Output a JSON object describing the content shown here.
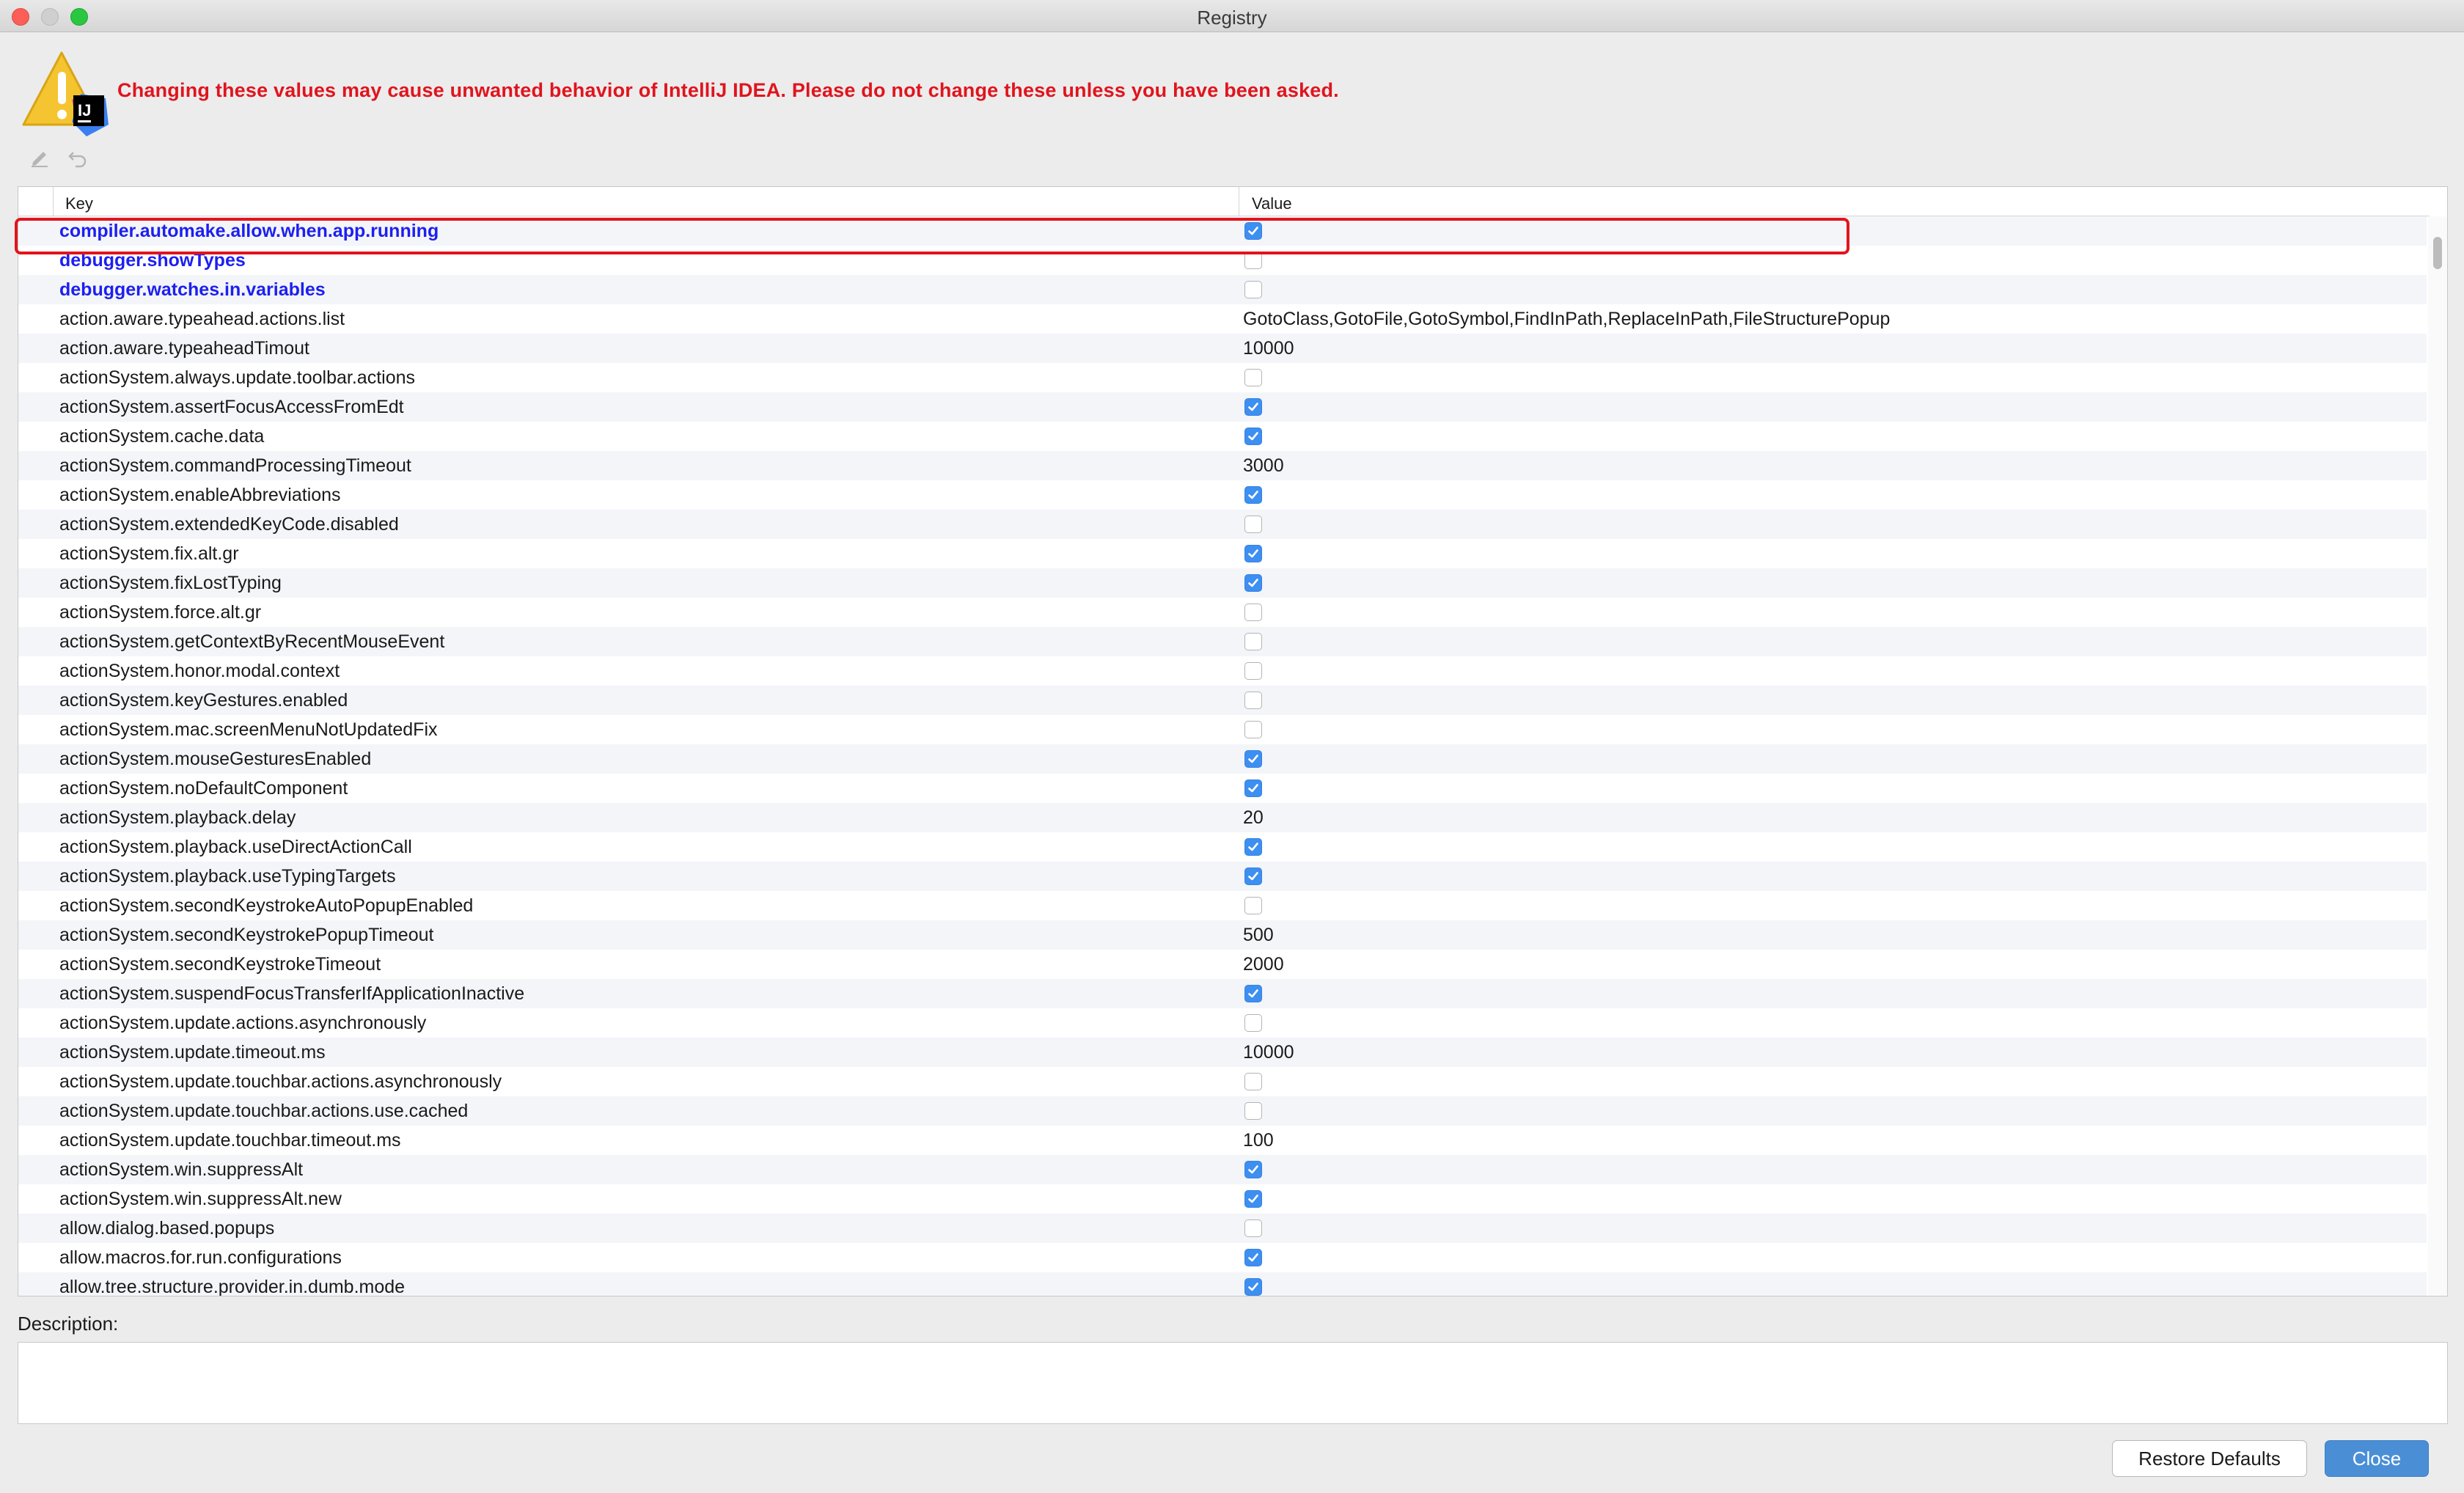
{
  "window": {
    "title": "Registry"
  },
  "warning": {
    "text": "Changing these values may cause unwanted behavior of IntelliJ IDEA. Please do not change these unless you have been asked.",
    "logo_text": "IJ"
  },
  "toolbar": {
    "edit_icon": "pencil-icon",
    "revert_icon": "undo-icon"
  },
  "table": {
    "columns": {
      "key": "Key",
      "value": "Value"
    },
    "rows": [
      {
        "key": "compiler.automake.allow.when.app.running",
        "type": "bool",
        "checked": true,
        "modified": true,
        "selected": true
      },
      {
        "key": "debugger.showTypes",
        "type": "bool",
        "checked": false,
        "modified": true
      },
      {
        "key": "debugger.watches.in.variables",
        "type": "bool",
        "checked": false,
        "modified": true
      },
      {
        "key": "action.aware.typeahead.actions.list",
        "type": "text",
        "value": "GotoClass,GotoFile,GotoSymbol,FindInPath,ReplaceInPath,FileStructurePopup"
      },
      {
        "key": "action.aware.typeaheadTimout",
        "type": "text",
        "value": "10000"
      },
      {
        "key": "actionSystem.always.update.toolbar.actions",
        "type": "bool",
        "checked": false
      },
      {
        "key": "actionSystem.assertFocusAccessFromEdt",
        "type": "bool",
        "checked": true
      },
      {
        "key": "actionSystem.cache.data",
        "type": "bool",
        "checked": true
      },
      {
        "key": "actionSystem.commandProcessingTimeout",
        "type": "text",
        "value": "3000"
      },
      {
        "key": "actionSystem.enableAbbreviations",
        "type": "bool",
        "checked": true
      },
      {
        "key": "actionSystem.extendedKeyCode.disabled",
        "type": "bool",
        "checked": false
      },
      {
        "key": "actionSystem.fix.alt.gr",
        "type": "bool",
        "checked": true
      },
      {
        "key": "actionSystem.fixLostTyping",
        "type": "bool",
        "checked": true
      },
      {
        "key": "actionSystem.force.alt.gr",
        "type": "bool",
        "checked": false
      },
      {
        "key": "actionSystem.getContextByRecentMouseEvent",
        "type": "bool",
        "checked": false
      },
      {
        "key": "actionSystem.honor.modal.context",
        "type": "bool",
        "checked": false
      },
      {
        "key": "actionSystem.keyGestures.enabled",
        "type": "bool",
        "checked": false
      },
      {
        "key": "actionSystem.mac.screenMenuNotUpdatedFix",
        "type": "bool",
        "checked": false
      },
      {
        "key": "actionSystem.mouseGesturesEnabled",
        "type": "bool",
        "checked": true
      },
      {
        "key": "actionSystem.noDefaultComponent",
        "type": "bool",
        "checked": true
      },
      {
        "key": "actionSystem.playback.delay",
        "type": "text",
        "value": "20"
      },
      {
        "key": "actionSystem.playback.useDirectActionCall",
        "type": "bool",
        "checked": true
      },
      {
        "key": "actionSystem.playback.useTypingTargets",
        "type": "bool",
        "checked": true
      },
      {
        "key": "actionSystem.secondKeystrokeAutoPopupEnabled",
        "type": "bool",
        "checked": false
      },
      {
        "key": "actionSystem.secondKeystrokePopupTimeout",
        "type": "text",
        "value": "500"
      },
      {
        "key": "actionSystem.secondKeystrokeTimeout",
        "type": "text",
        "value": "2000"
      },
      {
        "key": "actionSystem.suspendFocusTransferIfApplicationInactive",
        "type": "bool",
        "checked": true
      },
      {
        "key": "actionSystem.update.actions.asynchronously",
        "type": "bool",
        "checked": false
      },
      {
        "key": "actionSystem.update.timeout.ms",
        "type": "text",
        "value": "10000"
      },
      {
        "key": "actionSystem.update.touchbar.actions.asynchronously",
        "type": "bool",
        "checked": false
      },
      {
        "key": "actionSystem.update.touchbar.actions.use.cached",
        "type": "bool",
        "checked": false
      },
      {
        "key": "actionSystem.update.touchbar.timeout.ms",
        "type": "text",
        "value": "100"
      },
      {
        "key": "actionSystem.win.suppressAlt",
        "type": "bool",
        "checked": true
      },
      {
        "key": "actionSystem.win.suppressAlt.new",
        "type": "bool",
        "checked": true
      },
      {
        "key": "allow.dialog.based.popups",
        "type": "bool",
        "checked": false
      },
      {
        "key": "allow.macros.for.run.configurations",
        "type": "bool",
        "checked": true
      },
      {
        "key": "allow.tree.structure.provider.in.dumb.mode",
        "type": "bool",
        "checked": true
      }
    ]
  },
  "description": {
    "label": "Description:",
    "text": ""
  },
  "buttons": {
    "restore": "Restore Defaults",
    "close": "Close"
  },
  "colors": {
    "warning": "#e0141e",
    "modified_key": "#1d1ff0",
    "checkbox_checked": "#3d8ff0",
    "primary_button": "#4a8fd6",
    "highlight": "#e3141c"
  }
}
